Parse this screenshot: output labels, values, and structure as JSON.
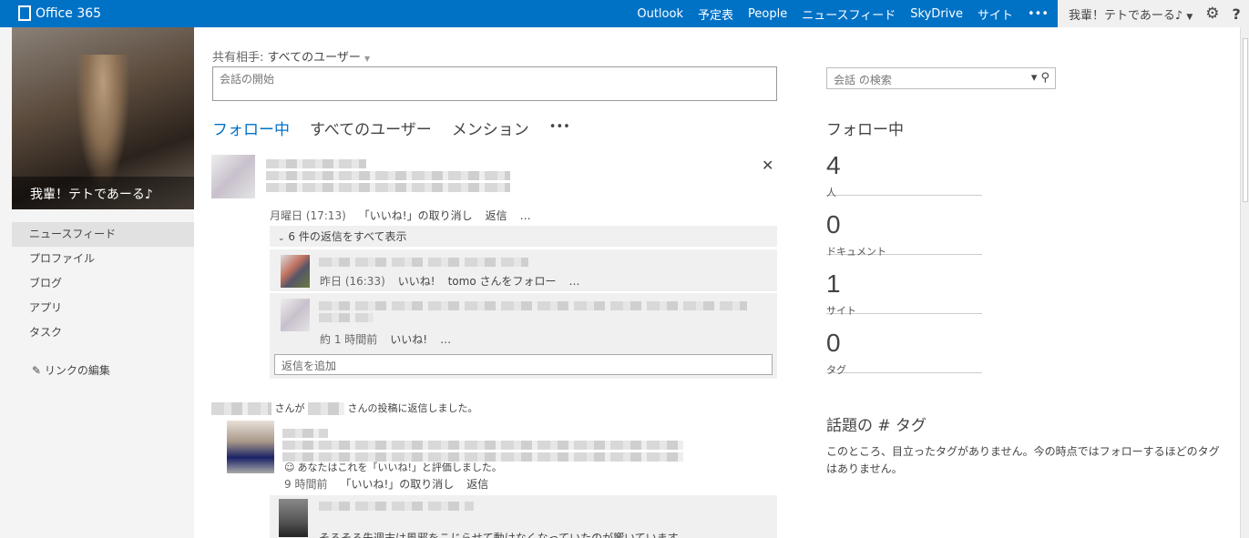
{
  "header": {
    "brand": "Office 365",
    "nav": [
      "Outlook",
      "予定表",
      "People",
      "ニュースフィード",
      "SkyDrive",
      "サイト",
      "•••"
    ],
    "user": "我輩！テトであーる♪"
  },
  "sidebar": {
    "profile_name": "我輩！テトであーる♪",
    "items": [
      "ニュースフィード",
      "プロファイル",
      "ブログ",
      "アプリ",
      "タスク"
    ],
    "edit_links": "リンクの編集"
  },
  "composer": {
    "share_label": "共有相手:",
    "share_value": "すべてのユーザー",
    "placeholder": "会話の開始"
  },
  "tabs": [
    "フォロー中",
    "すべてのユーザー",
    "メンション",
    "•••"
  ],
  "feed": {
    "post1": {
      "meta": [
        "月曜日 (17:13)",
        "「いいね!」の取り消し",
        "返信",
        "…"
      ],
      "show_replies": "6 件の返信をすべて表示",
      "reply1": [
        "昨日 (16:33)",
        "いいね!",
        "tomo さんをフォロー",
        "…"
      ],
      "reply2": [
        "約 1 時間前",
        "いいね!",
        "…"
      ],
      "add_reply": "返信を追加"
    },
    "post2": {
      "activity_mid": "さんが",
      "activity_end": "さんの投稿に返信しました。",
      "liked": "あなたはこれを「いいね!」と評価しました。",
      "meta": [
        "9 時間前",
        "「いいね!」の取り消し",
        "返信"
      ],
      "snippet": "そろそろ先週末は風邪をこじらせて動けなくなっていたのが響いています"
    }
  },
  "right": {
    "search_placeholder": "会話 の検索",
    "following_title": "フォロー中",
    "stats": [
      {
        "n": "4",
        "l": "人"
      },
      {
        "n": "0",
        "l": "ドキュメント"
      },
      {
        "n": "1",
        "l": "サイト"
      },
      {
        "n": "0",
        "l": "タグ"
      }
    ],
    "tags_title": "話題の # タグ",
    "tags_msg": "このところ、目立ったタグがありません。今の時点ではフォローするほどのタグはありません。"
  }
}
